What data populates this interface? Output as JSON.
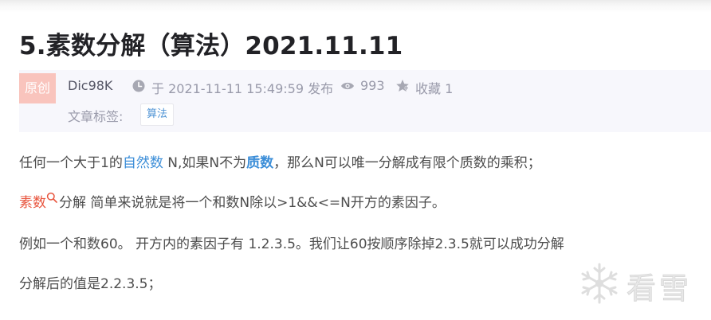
{
  "article": {
    "title": "5.素数分解（算法）2021.11.11",
    "badge": "原创",
    "author": "Dic98K",
    "date": "于 2021-11-11 15:49:59 发布",
    "views": "993",
    "favorites": "收藏 1",
    "tags_label": "文章标签:",
    "tag": "算法"
  },
  "body": {
    "p1": [
      "任何一个大于1的",
      "自然数",
      " N,如果N不为",
      "质数",
      "，那么N可以唯一分解成有限个质数的乘积；"
    ],
    "p2": [
      "素数",
      "分解  简单来说就是将一个和数N除以>1&&<=N开方的素因子。"
    ],
    "p3": "例如一个和数60。  开方内的素因子有 1.2.3.5。我们让60按顺序除掉2.3.5就可以成功分解",
    "p4": "分解后的值是2.2.3.5；"
  },
  "watermark": {
    "text": "看雪",
    "icon": "snowflake-icon"
  },
  "colors": {
    "link": "#3c8ed8",
    "highlight": "#e8553e",
    "badge": "#f9c4bd",
    "meta_bg": "#f7f7fc"
  }
}
